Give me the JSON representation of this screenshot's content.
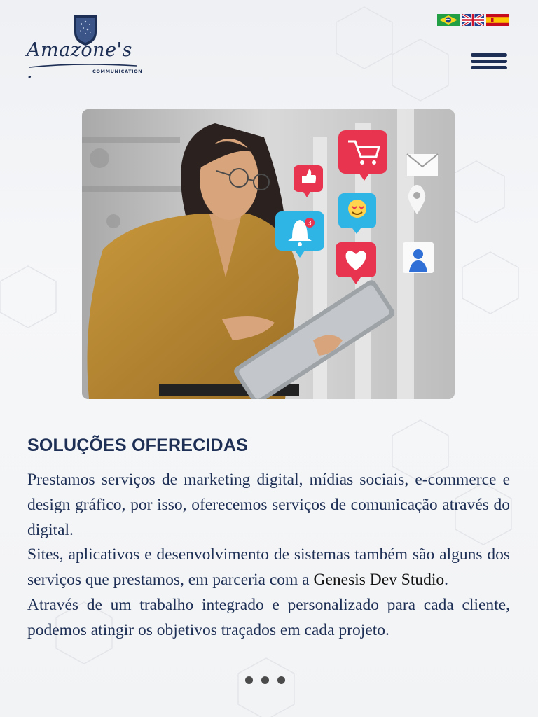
{
  "header": {
    "logo": {
      "name": "Amazone's .",
      "tagline": "COMMUNICATION"
    },
    "flags": [
      {
        "icon": "brazil-flag-icon"
      },
      {
        "icon": "uk-flag-icon"
      },
      {
        "icon": "spain-flag-icon"
      }
    ],
    "menu_icon": "hamburger-menu-icon"
  },
  "hero": {
    "floating_icons": [
      "shopping-cart-icon",
      "like-icon",
      "envelope-icon",
      "location-pin-icon",
      "notification-bell-icon",
      "emoji-icon",
      "heart-icon",
      "user-profile-icon"
    ],
    "notification_count": "3"
  },
  "section": {
    "title": "SOLUÇÕES OFERECIDAS",
    "paragraphs": {
      "p1": "Prestamos serviços de marketing digital, mídias sociais, e-commerce e design gráfico, por isso, oferecemos serviços de comunicação através do digital.",
      "p2_start": "Sites, aplicativos e desenvolvimento de sistemas também são alguns dos serviços que prestamos, em parceria com a ",
      "p2_partner": "Genesis Dev Studio",
      "p2_end": ".",
      "p3": "Através de um trabalho integrado e personalizado para cada cliente, podemos atingir os  objetivos traçados em cada projeto."
    }
  },
  "carousel": {
    "dot_count": 3
  },
  "colors": {
    "brand_navy": "#1e2f55",
    "icon_red": "#e8344e",
    "icon_blue": "#2fb4e6",
    "dot_gray": "#4b4b4b"
  }
}
